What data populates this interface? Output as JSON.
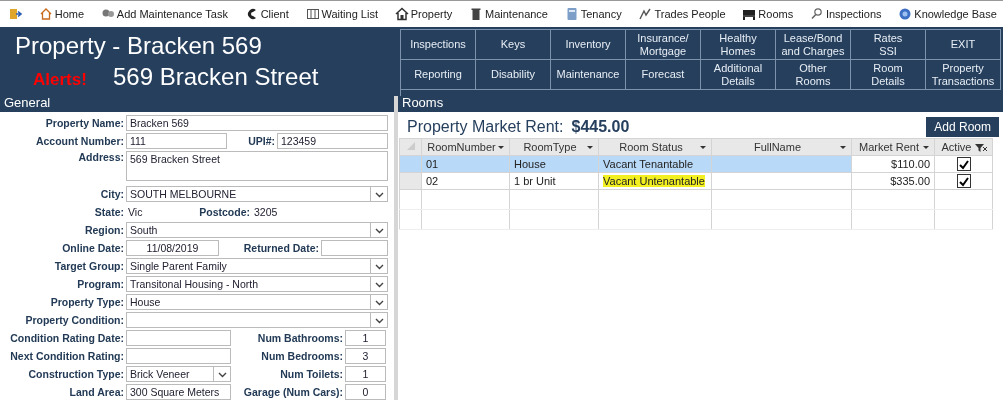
{
  "toolbar": [
    {
      "label": "Home"
    },
    {
      "label": "Add Maintenance Task"
    },
    {
      "label": "Client"
    },
    {
      "label": "Waiting List"
    },
    {
      "label": "Property"
    },
    {
      "label": "Maintenance"
    },
    {
      "label": "Tenancy"
    },
    {
      "label": "Trades People"
    },
    {
      "label": "Rooms"
    },
    {
      "label": "Inspections"
    },
    {
      "label": "Knowledge Base"
    }
  ],
  "header": {
    "title": "Property - Bracken 569",
    "alert": "Alerts!",
    "address": "569 Bracken Street"
  },
  "nav_buttons": [
    [
      {
        "lines": [
          "Inspections"
        ]
      },
      {
        "lines": [
          "Keys"
        ]
      },
      {
        "lines": [
          "Inventory"
        ]
      },
      {
        "lines": [
          "Insurance/",
          "Mortgage"
        ]
      },
      {
        "lines": [
          "Healthy",
          "Homes"
        ]
      },
      {
        "lines": [
          "Lease/Bond",
          "and Charges"
        ]
      },
      {
        "lines": [
          "Rates",
          "SSI"
        ]
      },
      {
        "lines": [
          "EXIT"
        ]
      }
    ],
    [
      {
        "lines": [
          "Reporting"
        ]
      },
      {
        "lines": [
          "Disability"
        ]
      },
      {
        "lines": [
          "Maintenance"
        ]
      },
      {
        "lines": [
          "Forecast"
        ]
      },
      {
        "lines": [
          "Additional",
          "Details"
        ]
      },
      {
        "lines": [
          "Other",
          "Rooms"
        ]
      },
      {
        "lines": [
          "Room",
          "Details"
        ]
      },
      {
        "lines": [
          "Property",
          "Transactions"
        ]
      }
    ]
  ],
  "general": {
    "heading": "General",
    "rows": [
      {
        "kind": "text",
        "label": "Property Name:",
        "value": "Bracken 569"
      },
      {
        "kind": "pair",
        "label": "Account Number:",
        "value": "111",
        "label2": "UPI#:",
        "value2": "123459"
      },
      {
        "kind": "textarea",
        "label": "Address:",
        "value": "569 Bracken Street"
      },
      {
        "kind": "select",
        "label": "City:",
        "value": "SOUTH MELBOURNE"
      },
      {
        "kind": "static",
        "label": "State:",
        "value": "Vic",
        "label2": "Postcode:",
        "value2": "3205"
      },
      {
        "kind": "select",
        "label": "Region:",
        "value": "South"
      },
      {
        "kind": "date",
        "label": "Online Date:",
        "value": "11/08/2019",
        "label2": "Returned Date:"
      },
      {
        "kind": "select",
        "label": "Target Group:",
        "value": "Single Parent Family"
      },
      {
        "kind": "select",
        "label": "Program:",
        "value": "Transitonal Housing - North"
      },
      {
        "kind": "select",
        "label": "Property Type:",
        "value": "House"
      },
      {
        "kind": "select",
        "label": "Property Condition:"
      },
      {
        "kind": "split",
        "label": "Condition Rating Date:",
        "label2": "Num Bathrooms:",
        "value2": "1"
      },
      {
        "kind": "split",
        "label": "Next Condition Rating:",
        "label2": "Num Bedrooms:",
        "value2": "3"
      },
      {
        "kind": "split-select",
        "label": "Construction Type:",
        "value": "Brick Veneer",
        "label2": "Num Toilets:",
        "value2": "1"
      },
      {
        "kind": "split",
        "label": "Land Area:",
        "value": "300 Square Meters",
        "label2": "Garage (Num Cars):",
        "value2": "0"
      }
    ]
  },
  "rooms": {
    "heading": "Rooms",
    "rent_label": "Property Market Rent:",
    "rent_value": "$445.00",
    "add_button": "Add Room",
    "columns": [
      "RoomNumber",
      "RoomType",
      "Room Status",
      "FullName",
      "Market Rent",
      "Active"
    ],
    "rows": [
      {
        "number": "01",
        "type": "House",
        "status": "Vacant Tenantable",
        "highlighted": false,
        "rent": "$110.00",
        "active": true,
        "selected": true
      },
      {
        "number": "02",
        "type": "1 br Unit",
        "status": "Vacant Untenantable",
        "highlighted": true,
        "rent": "$335.00",
        "active": true,
        "selected": false
      }
    ]
  }
}
